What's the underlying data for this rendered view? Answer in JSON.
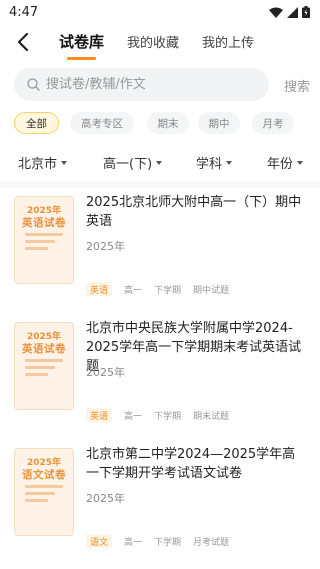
{
  "status": {
    "time": "4:47"
  },
  "tabs": [
    {
      "label": "试卷库",
      "active": true
    },
    {
      "label": "我的收藏",
      "active": false
    },
    {
      "label": "我的上传",
      "active": false
    }
  ],
  "search": {
    "placeholder": "搜试卷/教辅/作文",
    "value": "",
    "button_label": "搜索"
  },
  "chips": [
    {
      "label": "全部",
      "active": true
    },
    {
      "label": "高考专区",
      "active": false
    },
    {
      "label": "期末",
      "active": false
    },
    {
      "label": "期中",
      "active": false
    },
    {
      "label": "月考",
      "active": false
    }
  ],
  "filters": [
    {
      "label": "北京市"
    },
    {
      "label": "高一(下)"
    },
    {
      "label": "学科"
    },
    {
      "label": "年份"
    }
  ],
  "papers": [
    {
      "thumb_year": "2025年",
      "thumb_title": "英语试卷",
      "title": "2025北京北师大附中高一（下）期中英语",
      "year": "2025年",
      "subject": "英语",
      "grade": "高一",
      "term": "下学期",
      "type": "期中试题"
    },
    {
      "thumb_year": "2025年",
      "thumb_title": "英语试卷",
      "title": "北京市中央民族大学附属中学2024-2025学年高一下学期期末考试英语试题",
      "year": "2025年",
      "subject": "英语",
      "grade": "高一",
      "term": "下学期",
      "type": "期末试题"
    },
    {
      "thumb_year": "2025年",
      "thumb_title": "语文试卷",
      "title": "北京市第二中学2024—2025学年高一下学期开学考试语文试卷",
      "year": "2025年",
      "subject": "语文",
      "grade": "高一",
      "term": "下学期",
      "type": "月考试题"
    }
  ],
  "colors": {
    "accent": "#ff8a1f",
    "chip_active_bg": "#fff8de",
    "thumb_bg": "#fff3e8"
  }
}
